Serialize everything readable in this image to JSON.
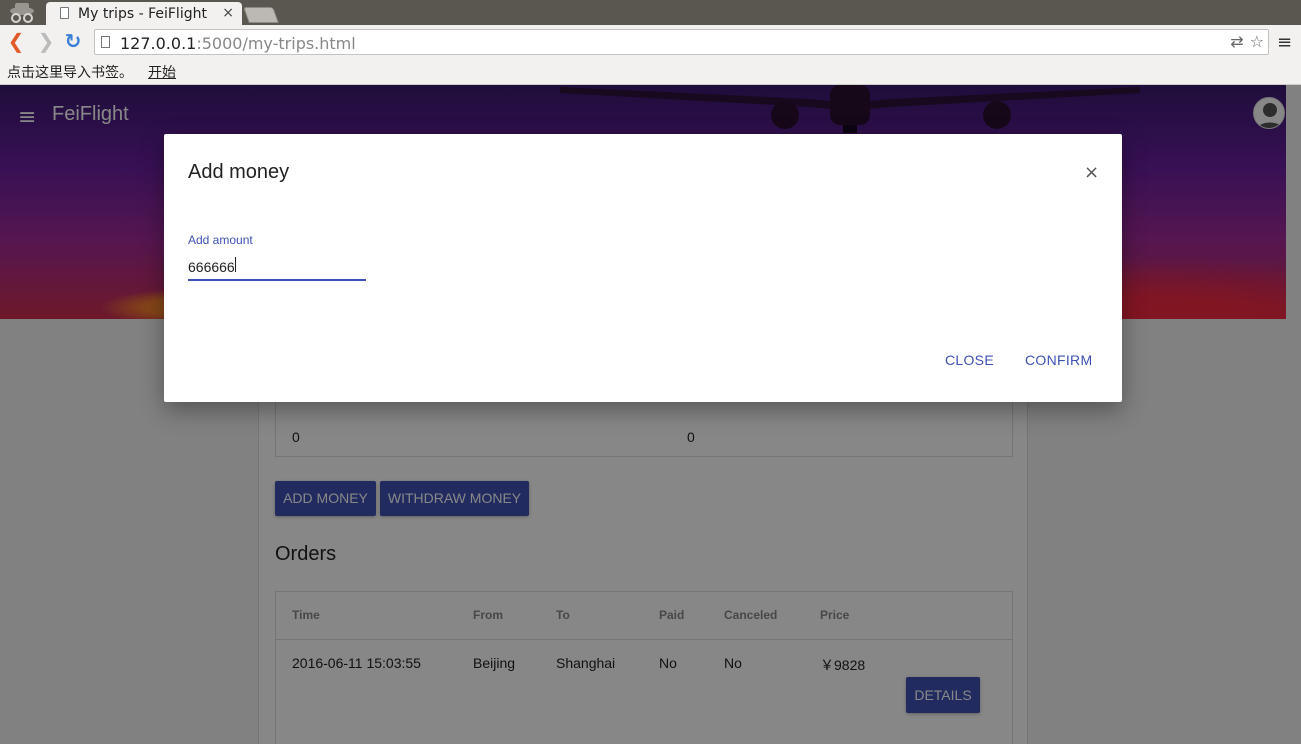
{
  "browser": {
    "tab_title": "My trips - FeiFlight",
    "tab_close": "×",
    "url_host": "127.0.0.1",
    "url_path": ":5000/my-trips.html",
    "bookmarks_prompt": "点击这里导入书签。",
    "bookmarks_link": "开始"
  },
  "app": {
    "brand": "FeiFlight",
    "menu_icon": "≡"
  },
  "balance": {
    "values": [
      "0",
      "0"
    ]
  },
  "buttons": {
    "add_money": "ADD MONEY",
    "withdraw_money": "WITHDRAW MONEY",
    "details": "DETAILS"
  },
  "orders": {
    "title": "Orders",
    "columns": [
      "Time",
      "From",
      "To",
      "Paid",
      "Canceled",
      "Price"
    ],
    "rows": [
      [
        "2016-06-11 15:03:55",
        "Beijing",
        "Shanghai",
        "No",
        "No",
        "￥9828"
      ]
    ]
  },
  "modal": {
    "title": "Add money",
    "close_x": "×",
    "field_label": "Add amount",
    "field_value": "666666",
    "close_label": "CLOSE",
    "confirm_label": "CONFIRM"
  },
  "colors": {
    "primary": "#3f51b5",
    "overlay": "rgba(0,0,0,0.47)"
  }
}
